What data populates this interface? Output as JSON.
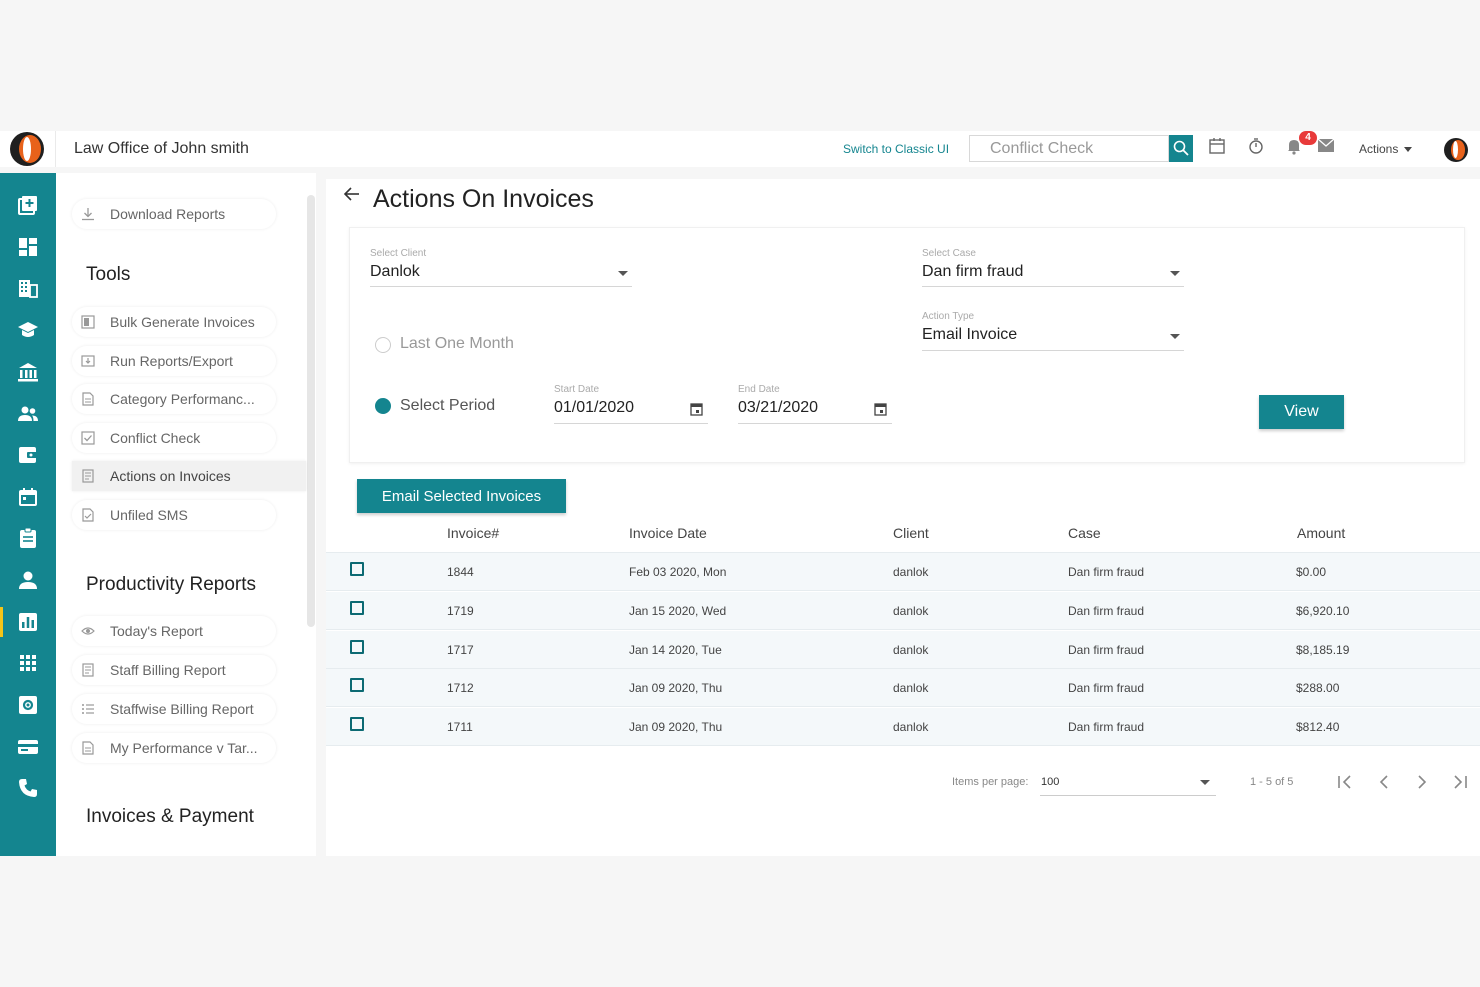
{
  "header": {
    "firm_name": "Law Office of John smith",
    "switch_label": "Switch to Classic UI",
    "search_placeholder": "Conflict Check",
    "notification_count": "4",
    "actions_label": "Actions"
  },
  "rail": {
    "icons": [
      "add-copy-icon",
      "dashboard-icon",
      "building-icon",
      "graduation-cap-icon",
      "bank-icon",
      "people-icon",
      "wallet-icon",
      "calendar-icon",
      "clipboard-icon",
      "person-icon",
      "bar-chart-icon",
      "apps-grid-icon",
      "settings-box-icon",
      "card-icon",
      "phone-icon"
    ],
    "active_index": 10
  },
  "side": {
    "download_reports": "Download Reports",
    "tools_title": "Tools",
    "tools": [
      {
        "label": "Bulk Generate Invoices",
        "icon": "bulk-icon"
      },
      {
        "label": "Run Reports/Export",
        "icon": "export-icon"
      },
      {
        "label": "Category Performanc...",
        "icon": "document-icon"
      },
      {
        "label": "Conflict Check",
        "icon": "checkbox-icon"
      },
      {
        "label": "Actions on Invoices",
        "icon": "invoice-icon"
      },
      {
        "label": "Unfiled SMS",
        "icon": "sms-icon"
      }
    ],
    "productivity_title": "Productivity Reports",
    "productivity": [
      {
        "label": "Today's Report",
        "icon": "eye-icon"
      },
      {
        "label": "Staff Billing Report",
        "icon": "invoice-icon"
      },
      {
        "label": "Staffwise Billing Report",
        "icon": "list-icon"
      },
      {
        "label": "My Performance v Tar...",
        "icon": "document-icon"
      }
    ],
    "invoices_title": "Invoices & Payment"
  },
  "page": {
    "title": "Actions On Invoices",
    "select_client_label": "Select Client",
    "select_client_value": "Danlok",
    "select_case_label": "Select Case",
    "select_case_value": "Dan firm fraud",
    "action_type_label": "Action Type",
    "action_type_value": "Email Invoice",
    "last_one_month": "Last One Month",
    "select_period": "Select Period",
    "start_date_label": "Start Date",
    "start_date_value": "01/01/2020",
    "end_date_label": "End Date",
    "end_date_value": "03/21/2020",
    "view_label": "View",
    "email_selected_label": "Email Selected Invoices"
  },
  "table": {
    "headers": [
      "Invoice#",
      "Invoice Date",
      "Client",
      "Case",
      "Amount"
    ],
    "rows": [
      [
        "1844",
        "Feb 03 2020, Mon",
        "danlok",
        "Dan firm fraud",
        "$0.00"
      ],
      [
        "1719",
        "Jan 15 2020, Wed",
        "danlok",
        "Dan firm fraud",
        "$6,920.10"
      ],
      [
        "1717",
        "Jan 14 2020, Tue",
        "danlok",
        "Dan firm fraud",
        "$8,185.19"
      ],
      [
        "1712",
        "Jan 09 2020, Thu",
        "danlok",
        "Dan firm fraud",
        "$288.00"
      ],
      [
        "1711",
        "Jan 09 2020, Thu",
        "danlok",
        "Dan firm fraud",
        "$812.40"
      ]
    ]
  },
  "pager": {
    "items_per_page_label": "Items per page:",
    "items_per_page_value": "100",
    "range": "1 - 5 of 5"
  },
  "colors": {
    "accent": "#14858f",
    "badge": "#e83a3a",
    "rail_active_marker": "#f5c518"
  }
}
